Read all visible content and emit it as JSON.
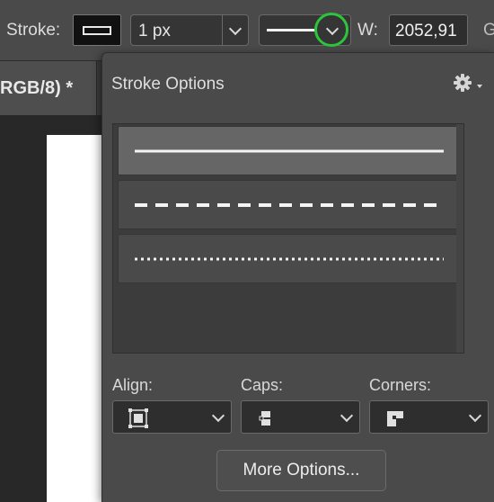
{
  "options_bar": {
    "stroke_label": "Stroke:",
    "stroke_width_value": "1 px",
    "width_label": "W:",
    "width_value": "2052,91",
    "overflow_glyph": "G"
  },
  "document_tab": {
    "title": "RGB/8) *"
  },
  "stroke_options": {
    "title": "Stroke Options",
    "settings_icon": "gear-icon",
    "presets": [
      {
        "style": "solid",
        "selected": true
      },
      {
        "style": "dashed",
        "selected": false
      },
      {
        "style": "dotted",
        "selected": false
      }
    ],
    "align_label": "Align:",
    "caps_label": "Caps:",
    "corners_label": "Corners:",
    "more_options_label": "More Options..."
  },
  "colors": {
    "highlight_ring": "#2cc63a",
    "panel_bg": "#4a4a4a",
    "selected_preset_bg": "#666666"
  }
}
